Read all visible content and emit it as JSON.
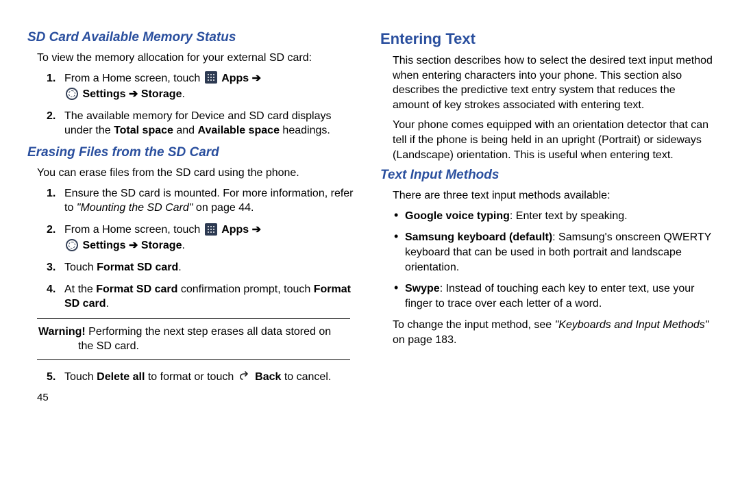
{
  "left": {
    "h1": "SD Card Available Memory Status",
    "intro": "To view the memory allocation for your external SD card:",
    "step1_a": "From a Home screen, touch ",
    "step1_apps": "Apps",
    "step1_settings": "Settings",
    "step1_storage": "Storage",
    "step2_a": "The available memory for Device and SD card displays under the ",
    "step2_b": "Total space",
    "step2_c": " and ",
    "step2_d": "Available space",
    "step2_e": " headings.",
    "h2": "Erasing Files from the SD Card",
    "intro2": "You can erase files from the SD card using the phone.",
    "e1_a": "Ensure the SD card is mounted. For more information, refer to ",
    "e1_b": "\"Mounting the SD Card\"",
    "e1_c": " on page 44.",
    "e2_a": "From a Home screen, touch ",
    "e3_a": "Touch ",
    "e3_b": "Format SD card",
    "e4_a": "At the ",
    "e4_b": "Format SD card",
    "e4_c": " confirmation prompt, touch ",
    "e4_d": "Format SD card",
    "warn_label": "Warning!",
    "warn_text1": " Performing the next step erases all data stored on ",
    "warn_text2": "the SD card.",
    "e5_a": "Touch ",
    "e5_b": "Delete all",
    "e5_c": " to format or touch ",
    "e5_back": "Back",
    "e5_d": " to cancel.",
    "pagenum": "45"
  },
  "right": {
    "h1": "Entering Text",
    "p1": "This section describes how to select the desired text input method when entering characters into your phone. This section also describes the predictive text entry system that reduces the amount of key strokes associated with entering text.",
    "p2": "Your phone comes equipped with an orientation detector that can tell if the phone is being held in an upright (Portrait) or sideways (Landscape) orientation. This is useful when entering text.",
    "h2": "Text Input Methods",
    "intro": "There are three text input methods available:",
    "b1_a": "Google voice typing",
    "b1_b": ": Enter text by speaking.",
    "b2_a": "Samsung keyboard (default)",
    "b2_b": ": Samsung's onscreen QWERTY keyboard that can be used in both portrait and landscape orientation.",
    "b3_a": "Swype",
    "b3_b": ": Instead of touching each key to enter text, use your finger to trace over each letter of a word.",
    "p3_a": "To change the input method, see ",
    "p3_b": "\"Keyboards and Input Methods\"",
    "p3_c": " on page 183."
  },
  "nums": {
    "n1": "1.",
    "n2": "2.",
    "n3": "3.",
    "n4": "4.",
    "n5": "5."
  },
  "arrow": "➔",
  "period": "."
}
